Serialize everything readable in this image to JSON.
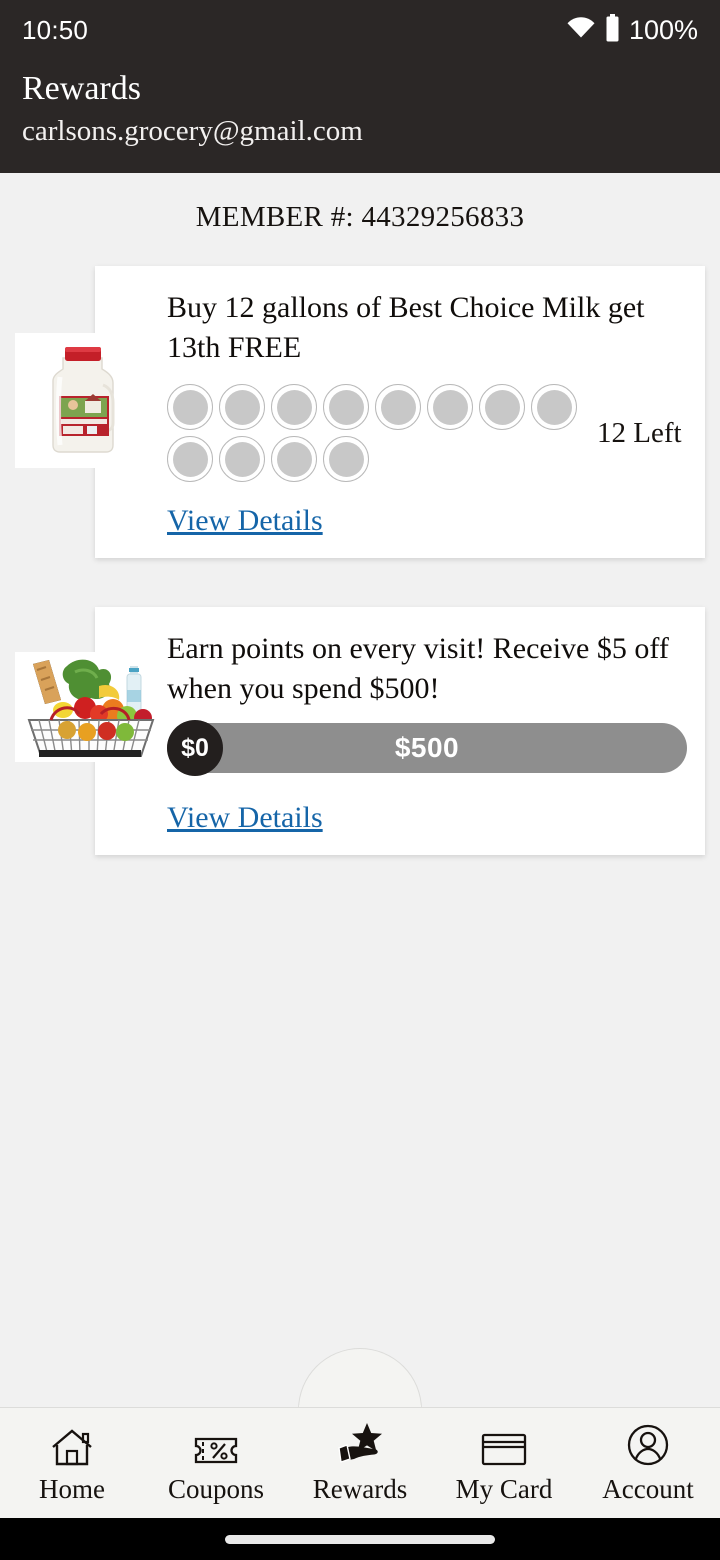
{
  "status_bar": {
    "time": "10:50",
    "battery_percent": "100%",
    "wifi_icon": "wifi-icon",
    "battery_icon": "battery-icon"
  },
  "header": {
    "title": "Rewards",
    "account_email": "carlsons.grocery@gmail.com"
  },
  "member": {
    "label": "MEMBER #: 44329256833"
  },
  "rewards": [
    {
      "id": "milk-punch-card",
      "title": "Buy 12 gallons of Best Choice Milk get 13th FREE",
      "image_name": "milk-gallon-image",
      "punch_total": 12,
      "punch_filled": 0,
      "remaining_label": "12 Left",
      "link_label": "View Details"
    },
    {
      "id": "spend-points-card",
      "title": "Earn points on every visit! Receive $5 off when you spend $500!",
      "image_name": "grocery-basket-image",
      "progress_current": "$0",
      "progress_max": "$500",
      "progress_percent": 0,
      "link_label": "View Details"
    }
  ],
  "bottom_nav": {
    "active": "Rewards",
    "items": [
      {
        "label": "Home",
        "icon": "home-icon"
      },
      {
        "label": "Coupons",
        "icon": "coupon-percent-icon"
      },
      {
        "label": "Rewards",
        "icon": "hand-star-icon"
      },
      {
        "label": "My Card",
        "icon": "credit-card-icon"
      },
      {
        "label": "Account",
        "icon": "person-circle-icon"
      }
    ]
  },
  "colors": {
    "header_bg": "#2b2726",
    "page_bg": "#f1f1f1",
    "card_bg": "#ffffff",
    "link": "#1565a8",
    "progress_track": "#8e8e8e",
    "progress_knob": "#231f1e",
    "nav_bg": "#f4f4f2",
    "punch_fill": "#c8c8c8"
  }
}
